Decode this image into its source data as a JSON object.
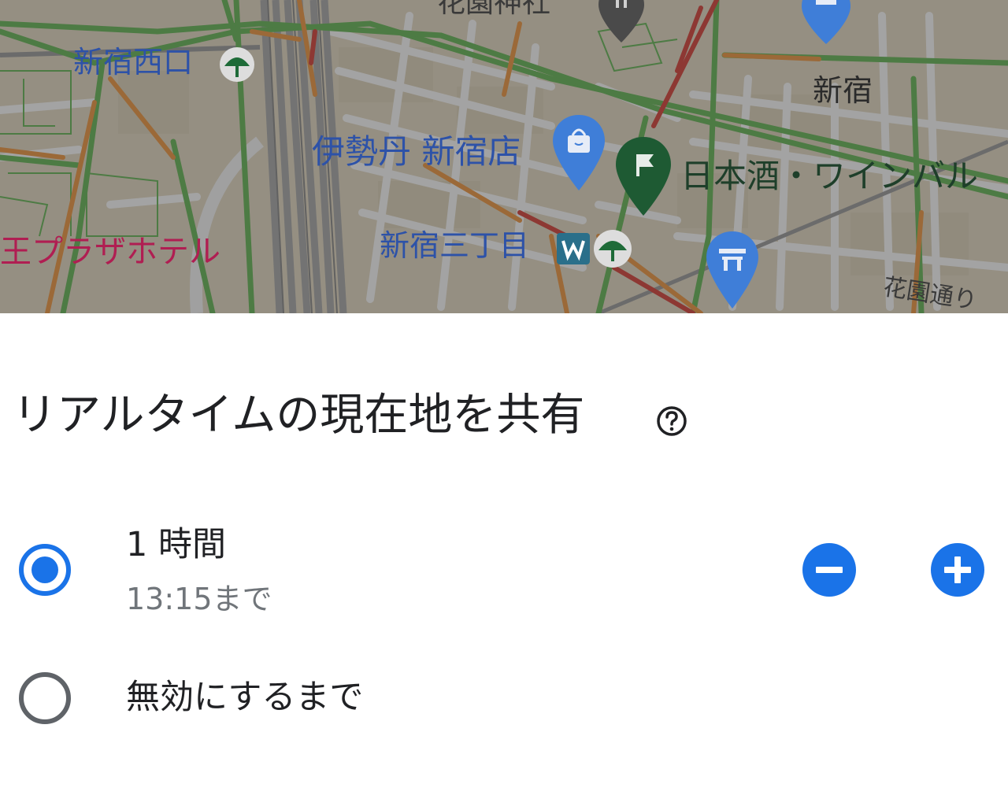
{
  "map": {
    "labels": {
      "hanazono_jinja": "花園神社",
      "shinjuku_nishiguchi": "新宿西口",
      "shinjuku": "新宿",
      "isetan": "伊勢丹 新宿店",
      "nihonshu_bar": "日本酒・ワインバル",
      "keio_plaza": "王プラザホテル",
      "shinjuku_sanchome": "新宿三丁目",
      "hanazono_dori": "花園通り"
    },
    "colors": {
      "traffic_green": "#5aa94a",
      "traffic_orange": "#e08a36",
      "traffic_red": "#c8362d",
      "label_blue": "#2d52a8",
      "label_red": "#b01e52",
      "label_green": "#1e5a33",
      "pin_blue": "#3f7ed8",
      "pin_green": "#1e6b38"
    }
  },
  "sheet": {
    "title": "リアルタイムの現在地を共有",
    "help_icon": "help-circle-icon",
    "options": [
      {
        "label": "1 時間",
        "sublabel": "13:15まで",
        "selected": true
      },
      {
        "label": "無効にするまで",
        "selected": false
      }
    ],
    "decrease_icon": "minus-icon",
    "increase_icon": "plus-icon",
    "accent_color": "#1a73e8"
  }
}
